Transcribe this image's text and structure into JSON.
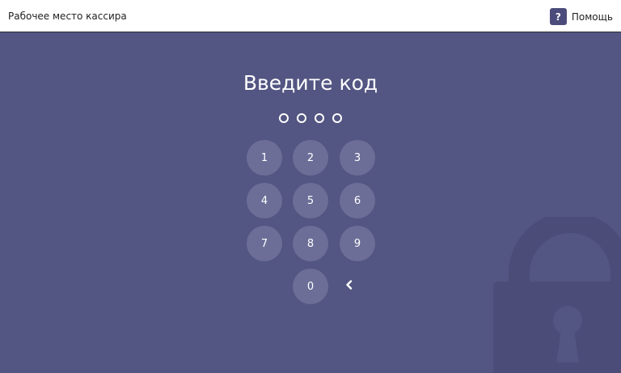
{
  "header": {
    "title": "Рабочее место кассира",
    "help_icon_glyph": "?",
    "help_label": "Помощь"
  },
  "pin": {
    "heading": "Введите код",
    "length": 4,
    "entered": 0
  },
  "keypad": {
    "keys": [
      "1",
      "2",
      "3",
      "4",
      "5",
      "6",
      "7",
      "8",
      "9",
      "0"
    ],
    "backspace_icon": "chevron-left-icon"
  },
  "colors": {
    "background": "#535582",
    "key_fill": "#6c6e98",
    "lock_fill": "#4b4d78",
    "help_icon_bg": "#4c4c7c"
  }
}
